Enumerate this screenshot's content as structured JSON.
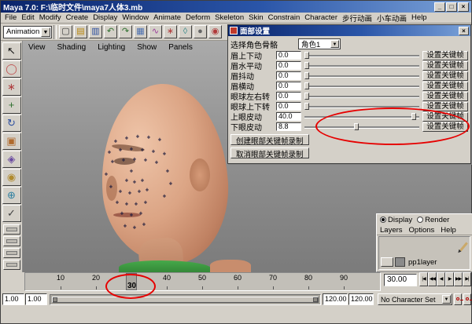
{
  "window": {
    "title": "Maya 7.0:  F:\\临时文件\\maya7人体3.mb",
    "buttons": {
      "minimize": "_",
      "maximize": "□",
      "close": "×"
    }
  },
  "menu_bar": {
    "items": [
      "File",
      "Edit",
      "Modify",
      "Create",
      "Display",
      "Window",
      "Animate",
      "Deform",
      "Skeleton",
      "Skin",
      "Constrain",
      "Character",
      "步行动画",
      "小车动画",
      "Help"
    ]
  },
  "toolbar": {
    "mode_selector": "Animation",
    "dropdown_arrow": "▼",
    "icons": [
      {
        "name": "new-scene-icon",
        "glyph": "▢",
        "color": "#3a3a3a"
      },
      {
        "name": "open-scene-icon",
        "glyph": "▤",
        "color": "#b8860b"
      },
      {
        "name": "save-scene-icon",
        "glyph": "▥",
        "color": "#2d4fa0"
      },
      {
        "name": "undo-icon",
        "glyph": "↶",
        "color": "#2d6f2d"
      },
      {
        "name": "redo-icon",
        "glyph": "↷",
        "color": "#2d6f2d"
      },
      {
        "name": "snap-grid-icon",
        "glyph": "▦",
        "color": "#4a6fb0"
      },
      {
        "name": "snap-curve-icon",
        "glyph": "∿",
        "color": "#9a3a9a"
      },
      {
        "name": "snap-point-icon",
        "glyph": "∗",
        "color": "#b03a3a"
      },
      {
        "name": "make-live-icon",
        "glyph": "◊",
        "color": "#3a8a8a"
      },
      {
        "name": "render-icon",
        "glyph": "●",
        "color": "#666666"
      },
      {
        "name": "ipr-render-icon",
        "glyph": "◉",
        "color": "#b03a3a"
      }
    ]
  },
  "toolbox": {
    "tools": [
      {
        "name": "select-tool",
        "glyph": "↖",
        "color": "#101010"
      },
      {
        "name": "lasso-tool",
        "glyph": "◯",
        "color": "#c05050"
      },
      {
        "name": "paint-select-tool",
        "glyph": "∗",
        "color": "#b04040"
      },
      {
        "name": "move-tool",
        "glyph": "+",
        "color": "#2d6f2d"
      },
      {
        "name": "rotate-tool",
        "glyph": "↻",
        "color": "#2d4fa0"
      },
      {
        "name": "scale-tool",
        "glyph": "▣",
        "color": "#b06a2d"
      },
      {
        "name": "universal-manipulator-tool",
        "glyph": "◈",
        "color": "#6a4aa0"
      },
      {
        "name": "soft-mod-tool",
        "glyph": "◉",
        "color": "#b08a2d"
      },
      {
        "name": "show-manipulator-tool",
        "glyph": "⊕",
        "color": "#2d7fa0"
      },
      {
        "name": "last-tool",
        "glyph": "✓",
        "color": "#404040"
      }
    ],
    "layout_buttons": [
      "single-pane-layout",
      "four-pane-layout",
      "persp-outliner-layout",
      "two-pane-layout"
    ]
  },
  "viewport": {
    "menu_items": [
      "View",
      "Shading",
      "Lighting",
      "Show",
      "Panels"
    ],
    "marker_glyph": "+",
    "markers": [
      [
        118,
        128
      ],
      [
        132,
        124
      ],
      [
        146,
        122
      ],
      [
        160,
        123
      ],
      [
        174,
        126
      ],
      [
        110,
        142
      ],
      [
        124,
        139
      ],
      [
        138,
        138
      ],
      [
        152,
        139
      ],
      [
        166,
        141
      ],
      [
        180,
        144
      ],
      [
        114,
        154
      ],
      [
        128,
        152
      ],
      [
        142,
        151
      ],
      [
        156,
        152
      ],
      [
        170,
        155
      ],
      [
        138,
        166
      ],
      [
        132,
        178
      ],
      [
        142,
        180
      ],
      [
        152,
        178
      ],
      [
        124,
        192
      ],
      [
        136,
        194
      ],
      [
        148,
        192
      ],
      [
        158,
        190
      ],
      [
        120,
        206
      ],
      [
        132,
        208
      ],
      [
        144,
        208
      ],
      [
        156,
        206
      ],
      [
        126,
        220
      ],
      [
        138,
        222
      ],
      [
        150,
        220
      ],
      [
        112,
        186
      ],
      [
        106,
        170
      ],
      [
        184,
        166
      ],
      [
        188,
        182
      ],
      [
        180,
        198
      ],
      [
        130,
        236
      ],
      [
        142,
        238
      ],
      [
        154,
        234
      ]
    ]
  },
  "dialog": {
    "title": "面部设置",
    "close_glyph": "×",
    "subtitle": "选择角色骨骼",
    "character_dropdown": "角色1",
    "dropdown_arrow": "▼",
    "set_key_label": "设置关键帧",
    "sliders": [
      {
        "label": "眉上下动",
        "value": "0.0",
        "pct": 0
      },
      {
        "label": "眉水平动",
        "value": "0.0",
        "pct": 0
      },
      {
        "label": "眉抖动",
        "value": "0.0",
        "pct": 0
      },
      {
        "label": "眉横动",
        "value": "0.0",
        "pct": 0
      },
      {
        "label": "眼球左右转",
        "value": "0.0",
        "pct": 0
      },
      {
        "label": "眼球上下转",
        "value": "0.0",
        "pct": 0
      },
      {
        "label": "上眼皮动",
        "value": "40.0",
        "pct": 97
      },
      {
        "label": "下眼皮动",
        "value": "8.8",
        "pct": 45
      }
    ],
    "buttons": [
      "创建眼部关键帧录制",
      "取消眼部关键帧录制"
    ]
  },
  "layer_panel": {
    "radios": [
      {
        "label": "Display",
        "selected": true
      },
      {
        "label": "Render",
        "selected": false
      }
    ],
    "menu": [
      "Layers",
      "Options",
      "Help"
    ],
    "layer": {
      "name": "pp1layer"
    }
  },
  "timeline": {
    "ticks": [
      "10",
      "20",
      "30",
      "40",
      "50",
      "60",
      "70",
      "80",
      "90"
    ],
    "playhead_frame": 30,
    "playhead_frame_label": "30",
    "current_time_field": "30.00",
    "playback": [
      {
        "name": "go-to-start-button",
        "glyph": "|◀"
      },
      {
        "name": "step-back-button",
        "glyph": "◀◀"
      },
      {
        "name": "play-backward-button",
        "glyph": "◀"
      },
      {
        "name": "play-forward-button",
        "glyph": "▶"
      },
      {
        "name": "step-forward-button",
        "glyph": "▶▶"
      },
      {
        "name": "go-to-end-button",
        "glyph": "▶|"
      }
    ]
  },
  "range_bar": {
    "fields": [
      "1.00",
      "1.00",
      "120.00",
      "120.00"
    ],
    "character_set": "No Character Set",
    "dropdown_arrow": "▼"
  },
  "annotations": {
    "color": "#e60000",
    "items": [
      "lower-eyelid-slider-highlight",
      "frame-30-highlight"
    ]
  }
}
